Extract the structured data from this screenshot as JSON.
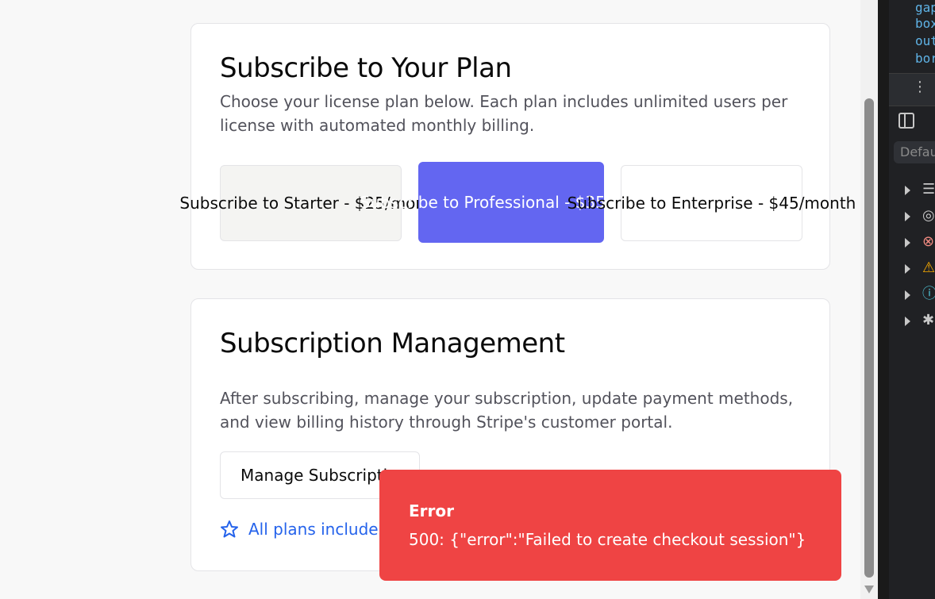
{
  "plan_section": {
    "title": "Subscribe to Your Plan",
    "description": "Choose your license plan below. Each plan includes unlimited users per license with automated monthly billing.",
    "plans": [
      {
        "label": "Subscribe to Starter - $25/month"
      },
      {
        "label": "Subscribe to Professional - $35/month"
      },
      {
        "label": "Subscribe to Enterprise - $45/month"
      }
    ]
  },
  "management_section": {
    "title": "Subscription Management",
    "description": "After subscribing, manage your subscription, update payment methods, and view billing history through Stripe's customer portal.",
    "manage_button": "Manage Subscription",
    "features_note": "All plans include a"
  },
  "toast": {
    "title": "Error",
    "message": "500: {\"error\":\"Failed to create checkout session\"}"
  },
  "devtools": {
    "code_lines": [
      "gap",
      "box",
      "out",
      "bor"
    ],
    "filter_placeholder": "Defau",
    "console_rows": [
      {
        "icon": "list-icon"
      },
      {
        "icon": "user-icon"
      },
      {
        "icon": "error-icon"
      },
      {
        "icon": "warning-icon"
      },
      {
        "icon": "info-icon"
      },
      {
        "icon": "bug-icon"
      }
    ]
  },
  "colors": {
    "primary": "#6366f1",
    "error": "#ef4444",
    "link": "#2563eb"
  }
}
